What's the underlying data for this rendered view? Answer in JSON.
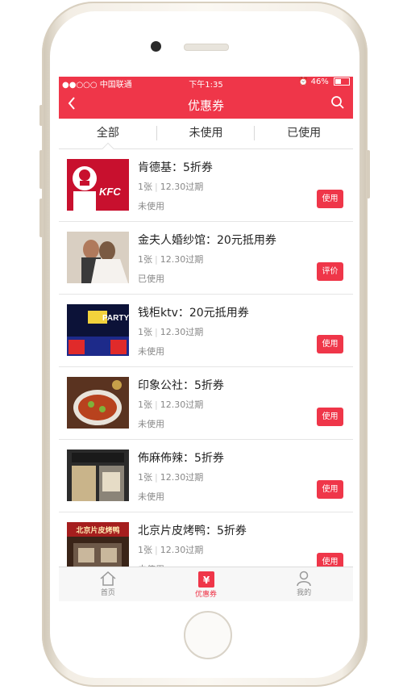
{
  "status": {
    "carrier": "●●○○○ 中国联通",
    "time": "下午1:35",
    "battery": "46%"
  },
  "nav": {
    "title": "优惠券"
  },
  "tabs": [
    {
      "label": "全部"
    },
    {
      "label": "未使用"
    },
    {
      "label": "已使用"
    }
  ],
  "coupons": [
    {
      "title": "肯德基：5折券",
      "count": "1张",
      "expiry": "12.30过期",
      "state": "未使用",
      "action": "使用"
    },
    {
      "title": "金夫人婚纱馆：20元抵用券",
      "count": "1张",
      "expiry": "12.30过期",
      "state": "已使用",
      "action": "评价"
    },
    {
      "title": "钱柜ktv：20元抵用券",
      "count": "1张",
      "expiry": "12.30过期",
      "state": "未使用",
      "action": "使用"
    },
    {
      "title": "印象公社：5折券",
      "count": "1张",
      "expiry": "12.30过期",
      "state": "未使用",
      "action": "使用"
    },
    {
      "title": "佈麻佈辣：5折券",
      "count": "1张",
      "expiry": "12.30过期",
      "state": "未使用",
      "action": "使用"
    },
    {
      "title": "北京片皮烤鸭：5折券",
      "count": "1张",
      "expiry": "12.30过期",
      "state": "未使用",
      "action": "使用"
    }
  ],
  "thumb_text": {
    "kfc": "KFC",
    "ktv": "PARTY",
    "duck": "北京片皮烤鸭"
  },
  "tabbar": [
    {
      "label": "首页",
      "icon": "home-icon"
    },
    {
      "label": "优惠券",
      "icon": "coupon-icon"
    },
    {
      "label": "我的",
      "icon": "profile-icon"
    }
  ],
  "colors": {
    "accent": "#ef3649"
  }
}
